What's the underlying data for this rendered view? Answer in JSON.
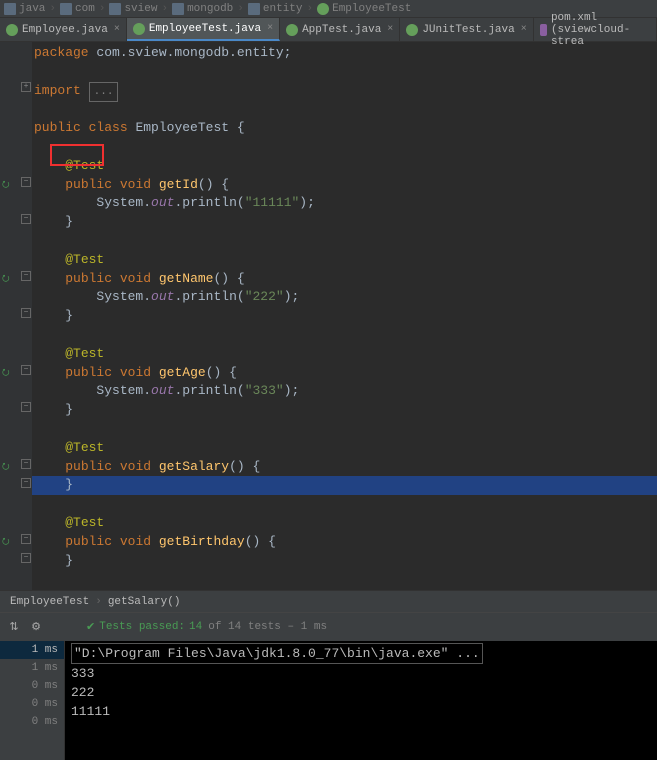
{
  "breadcrumb": [
    {
      "icon": "folder",
      "label": "java"
    },
    {
      "icon": "folder",
      "label": "com"
    },
    {
      "icon": "folder",
      "label": "sview"
    },
    {
      "icon": "folder",
      "label": "mongodb"
    },
    {
      "icon": "folder",
      "label": "entity"
    },
    {
      "icon": "class",
      "label": "EmployeeTest"
    }
  ],
  "tabs": [
    {
      "label": "Employee.java",
      "active": false,
      "icon": "class"
    },
    {
      "label": "EmployeeTest.java",
      "active": true,
      "icon": "class"
    },
    {
      "label": "AppTest.java",
      "active": false,
      "icon": "class"
    },
    {
      "label": "JUnitTest.java",
      "active": false,
      "icon": "class"
    },
    {
      "label": "pom.xml (sviewcloud-strea",
      "active": false,
      "icon": "xml"
    }
  ],
  "code": {
    "package_kw": "package",
    "package_name": "com.sview.mongodb.entity",
    "import_kw": "import",
    "fold_text": "...",
    "public_kw": "public",
    "class_kw": "class",
    "void_kw": "void",
    "class_name": "EmployeeTest",
    "test_ann": "@Test",
    "sys": "System",
    "out": "out",
    "println": "println",
    "methods": [
      {
        "name": "getId",
        "arg": "\"11111\""
      },
      {
        "name": "getName",
        "arg": "\"222\""
      },
      {
        "name": "getAge",
        "arg": "\"333\""
      },
      {
        "name": "getSalary",
        "arg": null
      },
      {
        "name": "getBirthday",
        "arg": null
      }
    ]
  },
  "crumb": {
    "class": "EmployeeTest",
    "method": "getSalary()"
  },
  "panel": {
    "pass_label": "Tests passed:",
    "pass_count": "14",
    "pass_of": "of 14 tests",
    "pass_time": "– 1 ms",
    "tree": [
      {
        "t": "1 ms",
        "sel": true
      },
      {
        "t": "1 ms",
        "sel": false
      },
      {
        "t": "0 ms",
        "sel": false
      },
      {
        "t": "0 ms",
        "sel": false
      },
      {
        "t": "0 ms",
        "sel": false
      }
    ],
    "console": [
      {
        "cmd": true,
        "text": "\"D:\\Program Files\\Java\\jdk1.8.0_77\\bin\\java.exe\" ..."
      },
      {
        "cmd": false,
        "text": "333"
      },
      {
        "cmd": false,
        "text": "222"
      },
      {
        "cmd": false,
        "text": "11111"
      }
    ]
  }
}
